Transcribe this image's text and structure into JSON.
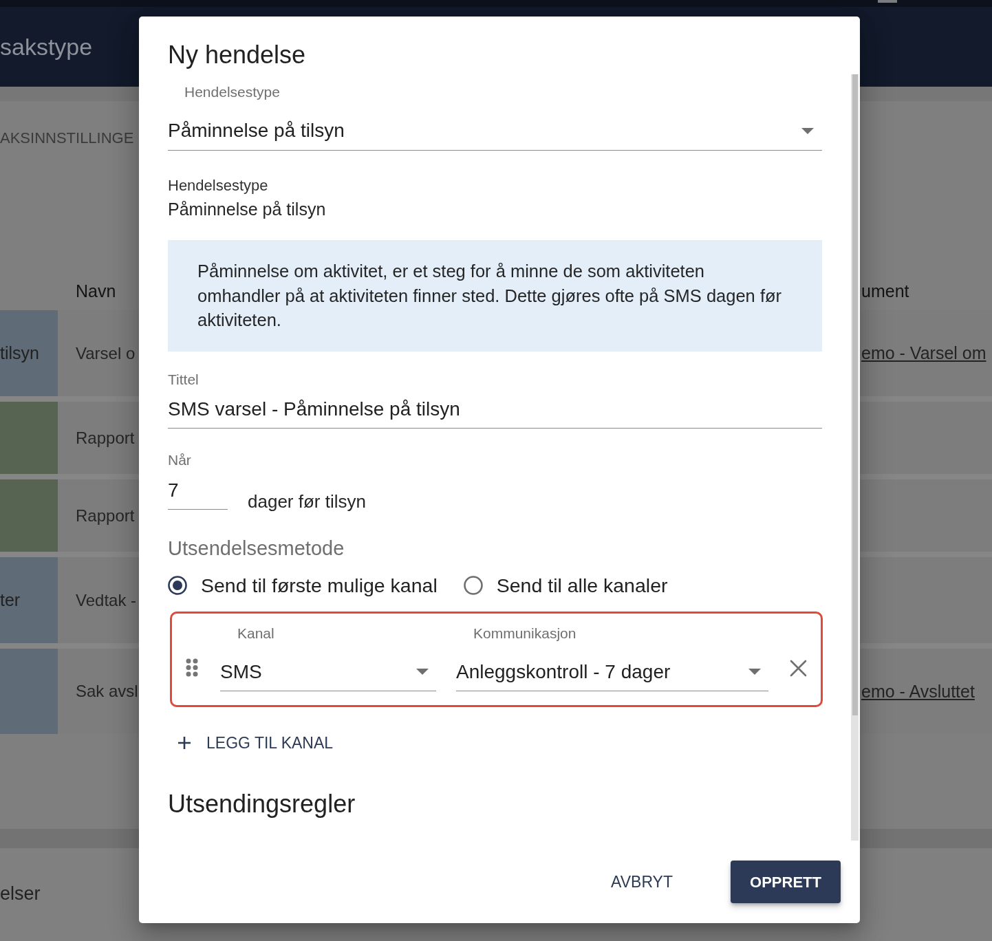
{
  "page": {
    "title": "sakstype",
    "settings_tab": "AKSINNSTILLINGE",
    "table": {
      "headings": {
        "navn": "Navn",
        "column_3": "ument"
      },
      "rows": [
        {
          "color": "#5f6b77",
          "column_1": "tilsyn",
          "navn": "Varsel o",
          "column_3": "emo - Varsel om"
        },
        {
          "color": "#566451",
          "navn": "Rapport"
        },
        {
          "color": "#566451",
          "navn": "Rapport"
        },
        {
          "color": "#5f6b77",
          "column_1": "ter",
          "navn": "Vedtak -"
        },
        {
          "color": "#5f6b77",
          "navn": "Sak avsl",
          "column_3": "emo - Avsluttet"
        }
      ]
    },
    "lower_section": "elser"
  },
  "dialog": {
    "title": "Ny hendelse",
    "event_type_select": {
      "label": "Hendelsestype",
      "value": "Påminnelse på tilsyn"
    },
    "event_type_summary": {
      "label": "Hendelsestype",
      "value": "Påminnelse på tilsyn"
    },
    "info_text": "Påminnelse om aktivitet, er et steg for å minne de som aktiviteten omhandler på at aktiviteten finner sted. Dette gjøres ofte på SMS dagen før aktiviteten.",
    "title_field": {
      "label": "Tittel",
      "value": "SMS varsel - Påminnelse på tilsyn"
    },
    "when_field": {
      "label": "Når",
      "value": "7",
      "suffix": "dager før tilsyn"
    },
    "send_method": {
      "heading": "Utsendelsesmetode",
      "options": [
        {
          "label": "Send til første mulige kanal",
          "selected": true
        },
        {
          "label": "Send til alle kanaler",
          "selected": false
        }
      ]
    },
    "channels": [
      {
        "highlighted": true,
        "channel": {
          "label": "Kanal",
          "value": "SMS"
        },
        "communication": {
          "label": "Kommunikasjon",
          "value": "Anleggskontroll - 7 dager"
        }
      }
    ],
    "add_channel_button": "LEGG TIL KANAL",
    "rules_heading": "Utsendingsregler",
    "buttons": [
      {
        "label": "AVBRYT",
        "kind": "text"
      },
      {
        "label": "OPPRETT",
        "kind": "contained"
      }
    ]
  }
}
